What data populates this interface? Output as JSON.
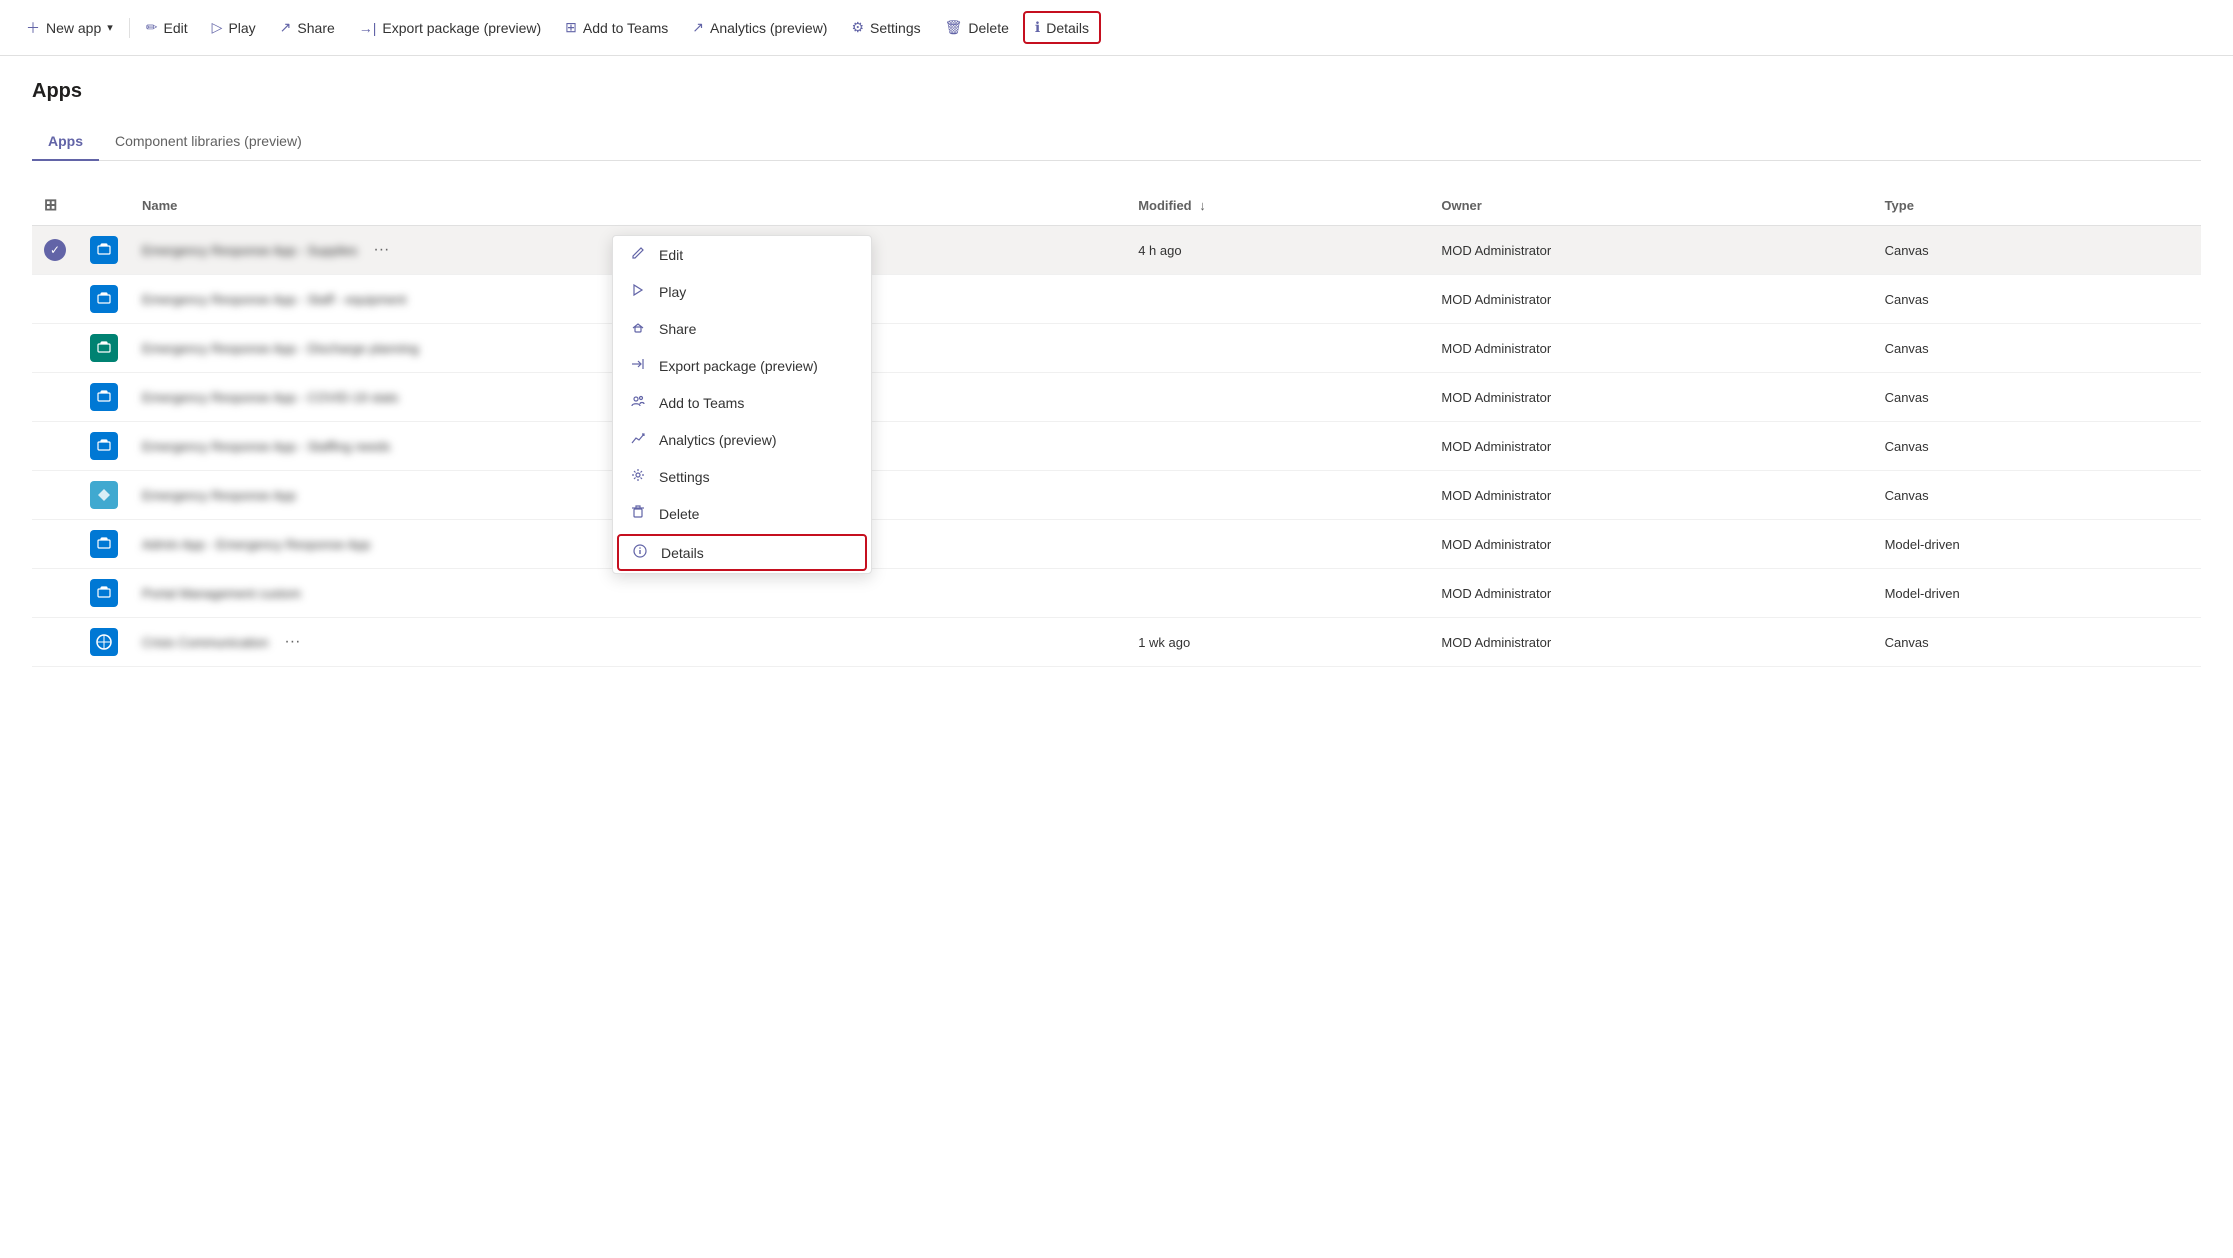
{
  "toolbar": {
    "new_app_label": "New app",
    "edit_label": "Edit",
    "play_label": "Play",
    "share_label": "Share",
    "export_label": "Export package (preview)",
    "add_to_teams_label": "Add to Teams",
    "analytics_label": "Analytics (preview)",
    "settings_label": "Settings",
    "delete_label": "Delete",
    "details_label": "Details"
  },
  "page": {
    "title": "Apps"
  },
  "tabs": [
    {
      "label": "Apps",
      "active": true
    },
    {
      "label": "Component libraries (preview)",
      "active": false
    }
  ],
  "table": {
    "columns": [
      {
        "key": "check",
        "label": ""
      },
      {
        "key": "icon",
        "label": ""
      },
      {
        "key": "name",
        "label": "Name"
      },
      {
        "key": "modified",
        "label": "Modified ↓"
      },
      {
        "key": "owner",
        "label": "Owner"
      },
      {
        "key": "type",
        "label": "Type"
      }
    ],
    "rows": [
      {
        "selected": true,
        "icon_type": "blue",
        "icon_char": "🔴",
        "name": "Emergency Response App - Supplies",
        "modified": "4 h ago",
        "owner": "MOD Administrator",
        "type": "Canvas",
        "has_dots": true
      },
      {
        "selected": false,
        "icon_type": "blue",
        "icon_char": "👥",
        "name": "Emergency Response App - Staff - equipment",
        "modified": "",
        "owner": "MOD Administrator",
        "type": "Canvas",
        "has_dots": false
      },
      {
        "selected": false,
        "icon_type": "teal",
        "icon_char": "🏥",
        "name": "Emergency Response App - Discharge planning",
        "modified": "",
        "owner": "MOD Administrator",
        "type": "Canvas",
        "has_dots": false
      },
      {
        "selected": false,
        "icon_type": "blue",
        "icon_char": "📊",
        "name": "Emergency Response App - COVID-19 stats",
        "modified": "",
        "owner": "MOD Administrator",
        "type": "Canvas",
        "has_dots": false
      },
      {
        "selected": false,
        "icon_type": "blue",
        "icon_char": "👤",
        "name": "Emergency Response App - Staffing needs",
        "modified": "",
        "owner": "MOD Administrator",
        "type": "Canvas",
        "has_dots": false
      },
      {
        "selected": false,
        "icon_type": "lightblue",
        "icon_char": "⚡",
        "name": "Emergency Response App",
        "modified": "",
        "owner": "MOD Administrator",
        "type": "Canvas",
        "has_dots": false
      },
      {
        "selected": false,
        "icon_type": "blue",
        "icon_char": "📋",
        "name": "Admin App - Emergency Response App",
        "modified": "",
        "owner": "MOD Administrator",
        "type": "Model-driven",
        "has_dots": false
      },
      {
        "selected": false,
        "icon_type": "blue",
        "icon_char": "📋",
        "name": "Portal Management custom",
        "modified": "",
        "owner": "MOD Administrator",
        "type": "Model-driven",
        "has_dots": false
      },
      {
        "selected": false,
        "icon_type": "globe",
        "icon_char": "🌐",
        "name": "Crisis Communication",
        "modified": "1 wk ago",
        "owner": "MOD Administrator",
        "type": "Canvas",
        "has_dots": true
      }
    ]
  },
  "context_menu": {
    "items": [
      {
        "label": "Edit",
        "icon": "✏️",
        "highlighted": false
      },
      {
        "label": "Play",
        "icon": "▷",
        "highlighted": false
      },
      {
        "label": "Share",
        "icon": "↗",
        "highlighted": false
      },
      {
        "label": "Export package (preview)",
        "icon": "→|",
        "highlighted": false
      },
      {
        "label": "Add to Teams",
        "icon": "👥",
        "highlighted": false
      },
      {
        "label": "Analytics (preview)",
        "icon": "↗",
        "highlighted": false
      },
      {
        "label": "Settings",
        "icon": "⚙",
        "highlighted": false
      },
      {
        "label": "Delete",
        "icon": "🗑",
        "highlighted": false
      },
      {
        "label": "Details",
        "icon": "ℹ",
        "highlighted": true
      }
    ]
  }
}
